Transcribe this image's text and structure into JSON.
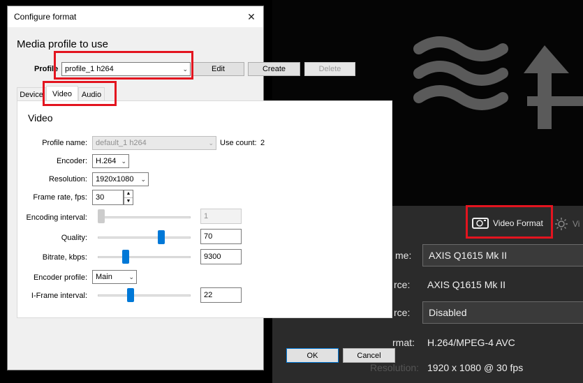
{
  "background_app": {
    "panel": {
      "tab_label": "Video Format",
      "partial_tab": "Vi",
      "fields": [
        {
          "label_fragment": "me:",
          "value": "AXIS Q1615 Mk II",
          "type": "select"
        },
        {
          "label_fragment": "rce:",
          "value": "AXIS Q1615 Mk II",
          "type": "text"
        },
        {
          "label_fragment": "rce:",
          "value": "Disabled",
          "type": "select"
        },
        {
          "label_fragment": "rmat:",
          "value": "H.264/MPEG-4 AVC",
          "type": "text"
        },
        {
          "label_fragment": "Resolution:",
          "value": "1920 x 1080 @ 30 fps",
          "type": "text"
        }
      ]
    },
    "colors": {
      "highlight": "#e3141f",
      "panel_bg": "#2b2b2b"
    }
  },
  "dialog": {
    "title": "Configure format",
    "close_glyph": "✕",
    "heading": "Media profile to use",
    "profile": {
      "label": "Profile",
      "value": "profile_1 h264",
      "edit": "Edit",
      "create": "Create",
      "delete": "Delete"
    },
    "tabs": [
      {
        "label": "Device",
        "active": false
      },
      {
        "label": "Video",
        "active": true
      },
      {
        "label": "Audio",
        "active": false
      }
    ],
    "video": {
      "title": "Video",
      "profile_name_label": "Profile name:",
      "profile_name_value": "default_1 h264",
      "use_count_label": "Use count:",
      "use_count_value": "2",
      "encoder_label": "Encoder:",
      "encoder_value": "H.264",
      "resolution_label": "Resolution:",
      "resolution_value": "1920x1080",
      "frame_rate_label": "Frame rate, fps:",
      "frame_rate_value": "30",
      "encoding_interval_label": "Encoding interval:",
      "encoding_interval_value": "1",
      "quality_label": "Quality:",
      "quality_value": "70",
      "bitrate_label": "Bitrate, kbps:",
      "bitrate_value": "9300",
      "encoder_profile_label": "Encoder profile:",
      "encoder_profile_value": "Main",
      "iframe_label": "I-Frame interval:",
      "iframe_value": "22"
    },
    "buttons": {
      "ok": "OK",
      "cancel": "Cancel"
    }
  },
  "icons": {
    "camera": "camera-icon",
    "brightness": "sun-icon",
    "close": "close-icon",
    "dropdown": "chevron-down-icon"
  }
}
